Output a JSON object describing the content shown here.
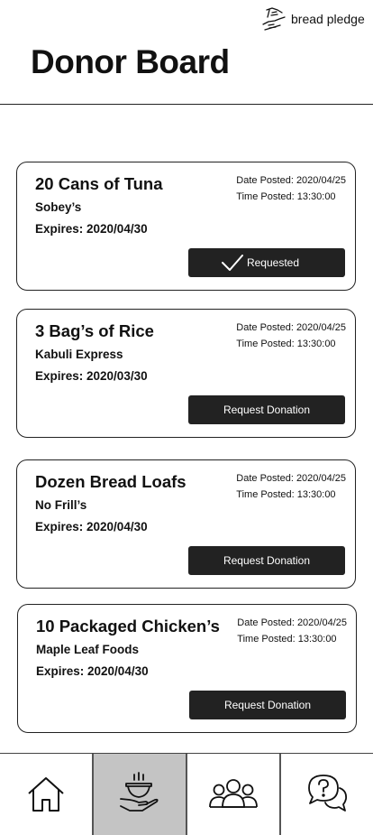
{
  "brand": {
    "name": "bread pledge",
    "icon": "hands-icon"
  },
  "page": {
    "title": "Donor Board"
  },
  "labels": {
    "date_prefix": "Date Posted: ",
    "time_prefix": "Time Posted: "
  },
  "cards": [
    {
      "title": "20 Cans of Tuna",
      "donor": "Sobey’s",
      "expires": "Expires: 2020/04/30",
      "date": "2020/04/25",
      "time": "13:30:00",
      "action_label": "Requested",
      "requested": true
    },
    {
      "title": "3 Bag’s of Rice",
      "donor": "Kabuli Express",
      "expires": "Expires: 2020/03/30",
      "date": "2020/04/25",
      "time": "13:30:00",
      "action_label": "Request Donation",
      "requested": false
    },
    {
      "title": "Dozen Bread Loafs",
      "donor": "No Frill’s",
      "expires": "Expires: 2020/04/30",
      "date": "2020/04/25",
      "time": "13:30:00",
      "action_label": "Request Donation",
      "requested": false
    },
    {
      "title": "10 Packaged Chicken’s",
      "donor": "Maple Leaf Foods",
      "expires": "Expires: 2020/04/30",
      "date": "2020/04/25",
      "time": "13:30:00",
      "action_label": "Request Donation",
      "requested": false
    }
  ],
  "nav": [
    {
      "icon": "home-icon",
      "active": false
    },
    {
      "icon": "food-donation-icon",
      "active": true
    },
    {
      "icon": "community-icon",
      "active": false
    },
    {
      "icon": "help-chat-icon",
      "active": false
    }
  ],
  "colors": {
    "button_bg": "#222222",
    "active_nav_bg": "#c4c4c4",
    "border": "#222222"
  }
}
